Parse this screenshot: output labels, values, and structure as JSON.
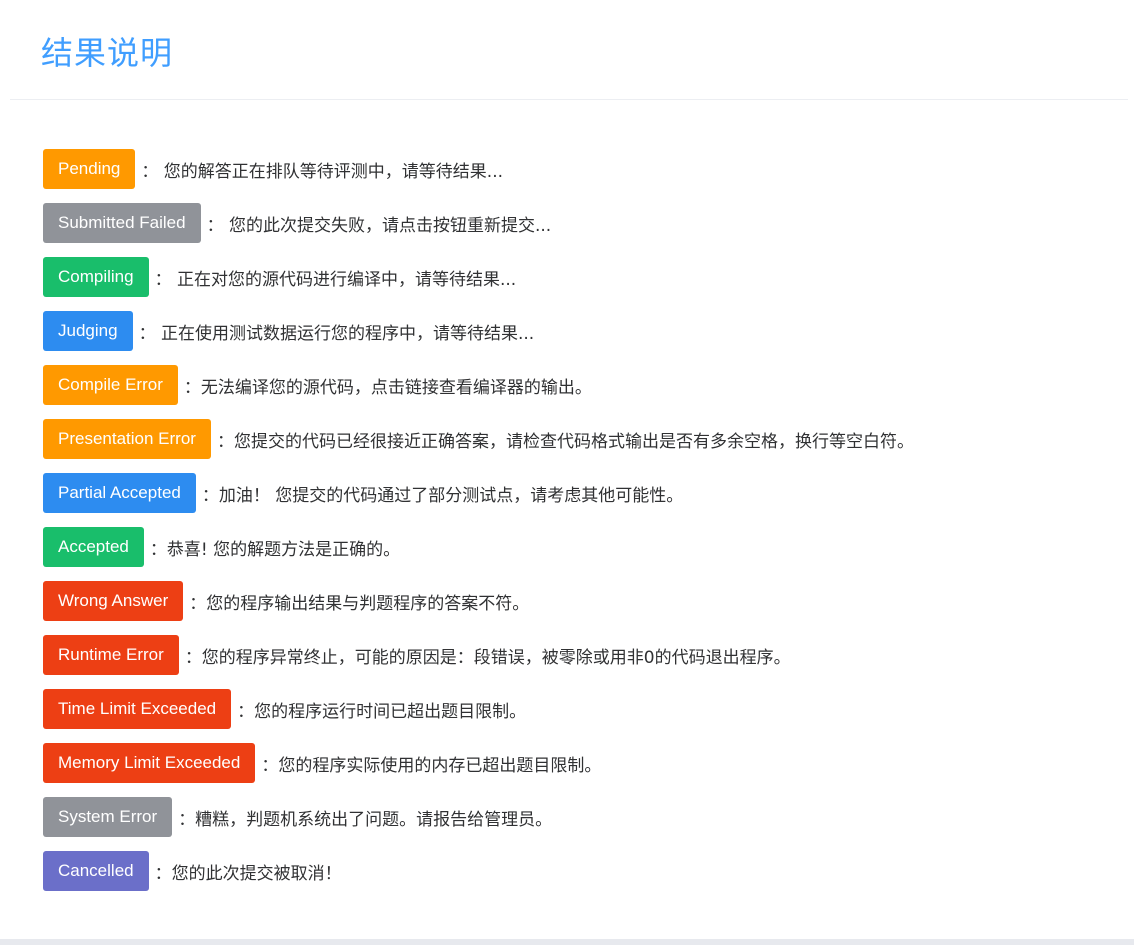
{
  "header": {
    "title": "结果说明"
  },
  "colors": {
    "orange": "#ff9900",
    "gray": "#909399",
    "green": "#19be6b",
    "blue": "#2d8cf0",
    "red": "#ed3f14",
    "purple": "#6b6fc9",
    "title": "#409eff"
  },
  "statuses": [
    {
      "label": "Pending",
      "color": "#ff9900",
      "desc": "：  您的解答正在排队等待评测中，请等待结果..."
    },
    {
      "label": "Submitted Failed",
      "color": "#909399",
      "desc": "：  您的此次提交失败，请点击按钮重新提交..."
    },
    {
      "label": "Compiling",
      "color": "#19be6b",
      "desc": "：  正在对您的源代码进行编译中，请等待结果..."
    },
    {
      "label": "Judging",
      "color": "#2d8cf0",
      "desc": "：  正在使用测试数据运行您的程序中，请等待结果..."
    },
    {
      "label": "Compile Error",
      "color": "#ff9900",
      "desc": "：无法编译您的源代码，点击链接查看编译器的输出。"
    },
    {
      "label": "Presentation Error",
      "color": "#ff9900",
      "desc": "：您提交的代码已经很接近正确答案，请检查代码格式输出是否有多余空格，换行等空白符。"
    },
    {
      "label": "Partial Accepted",
      "color": "#2d8cf0",
      "desc": "：加油！ 您提交的代码通过了部分测试点，请考虑其他可能性。"
    },
    {
      "label": "Accepted",
      "color": "#19be6b",
      "desc": "：恭喜! 您的解题方法是正确的。"
    },
    {
      "label": "Wrong Answer",
      "color": "#ed3f14",
      "desc": "：您的程序输出结果与判题程序的答案不符。"
    },
    {
      "label": "Runtime Error",
      "color": "#ed3f14",
      "desc": "：您的程序异常终止，可能的原因是：段错误，被零除或用非0的代码退出程序。"
    },
    {
      "label": "Time Limit Exceeded",
      "color": "#ed3f14",
      "desc": "：您的程序运行时间已超出题目限制。"
    },
    {
      "label": "Memory Limit Exceeded",
      "color": "#ed3f14",
      "desc": "：您的程序实际使用的内存已超出题目限制。"
    },
    {
      "label": "System Error",
      "color": "#909399",
      "desc": "：糟糕，判题机系统出了问题。请报告给管理员。"
    },
    {
      "label": "Cancelled",
      "color": "#6b6fc9",
      "desc": "：您的此次提交被取消！"
    }
  ]
}
